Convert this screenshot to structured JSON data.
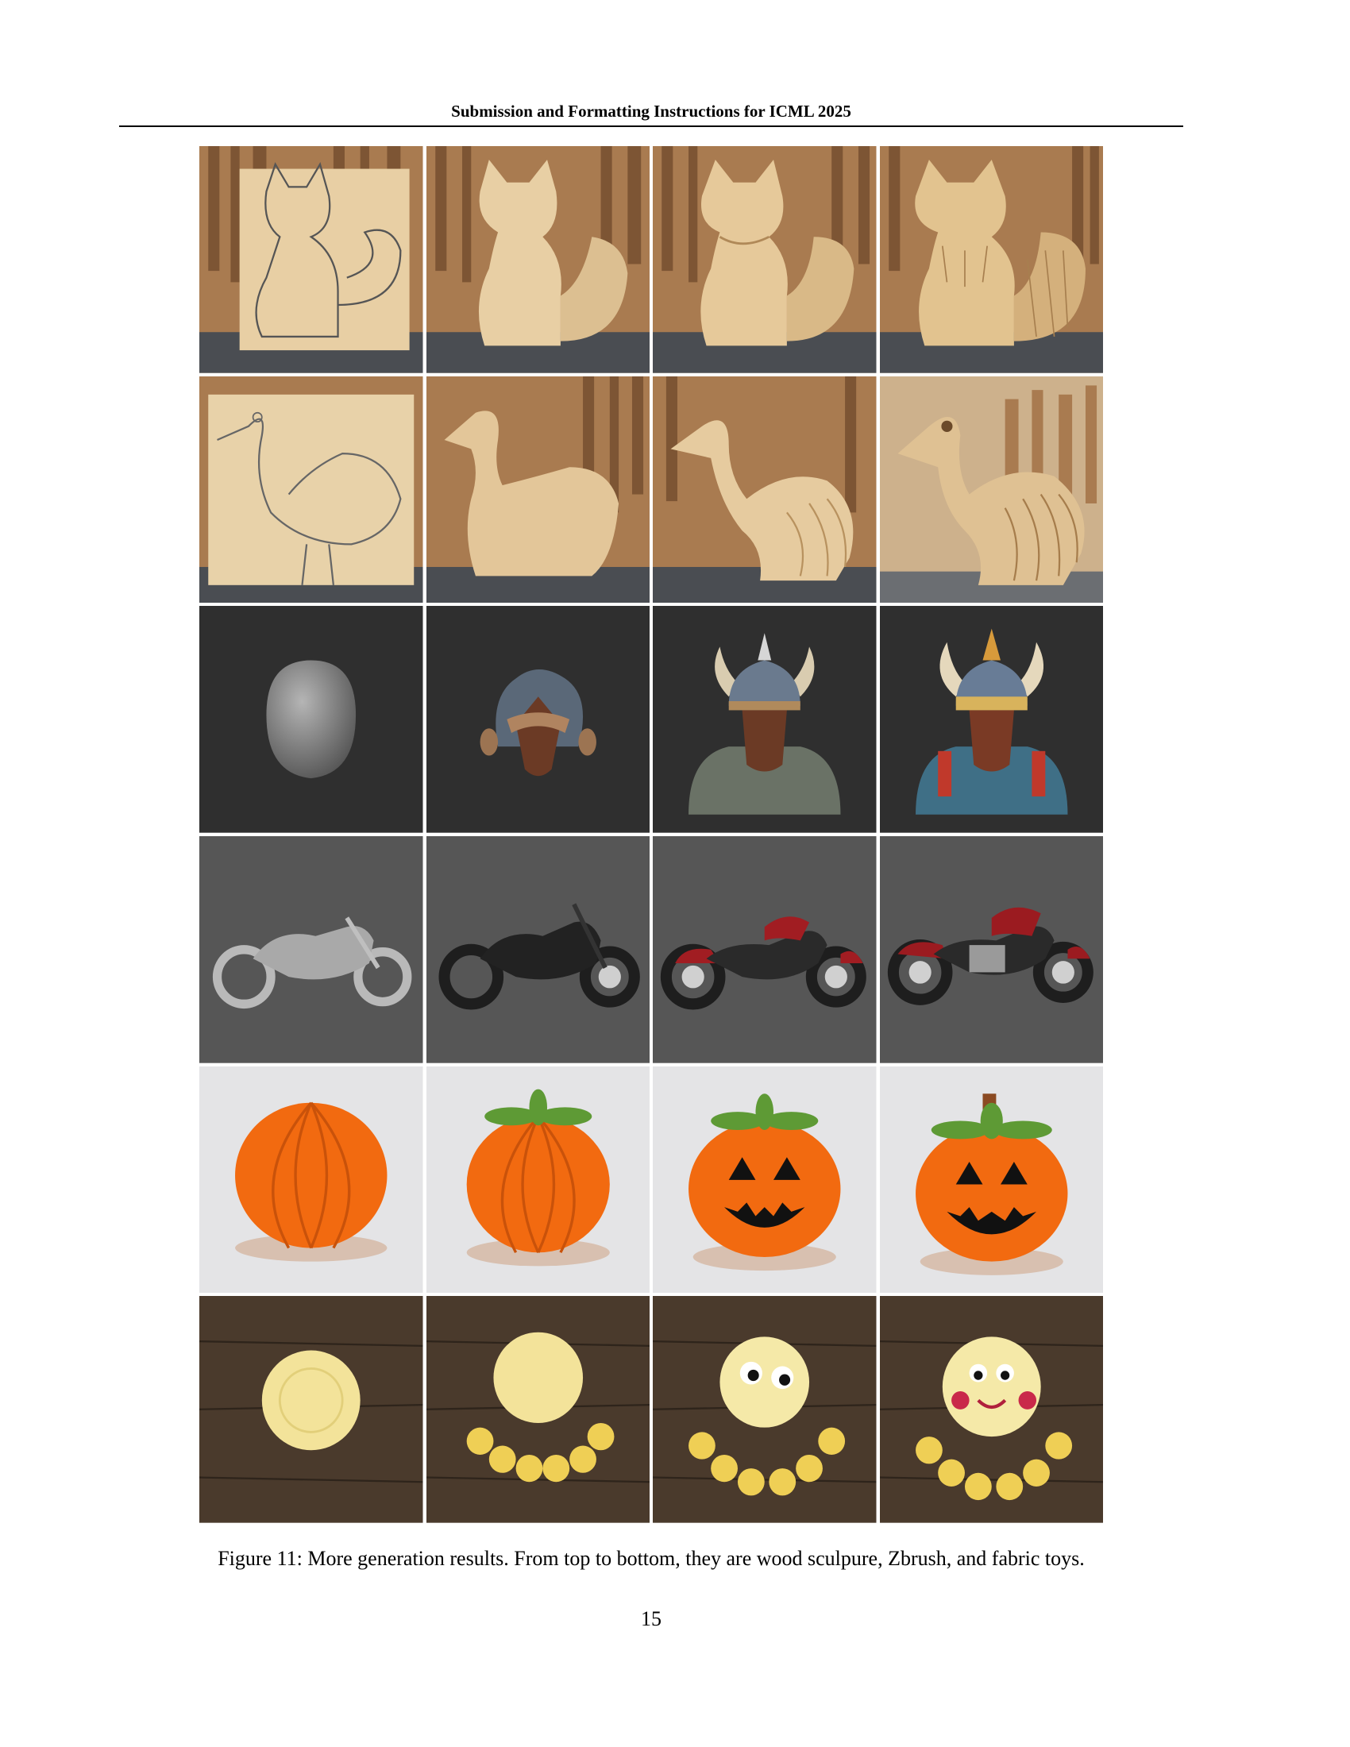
{
  "header": {
    "title": "Submission and Formatting Instructions for ICML 2025"
  },
  "figure": {
    "caption": "Figure 11: More generation results. From top to bottom, they are wood sculpure, Zbrush, and fabric toys.",
    "rows": [
      {
        "subject": "wooden fox carving",
        "background": "workshop"
      },
      {
        "subject": "wooden bird carving",
        "background": "workshop"
      },
      {
        "subject": "viking helmet bust",
        "background": "dark"
      },
      {
        "subject": "motorcycle",
        "background": "grey"
      },
      {
        "subject": "crochet pumpkin",
        "background": "light"
      },
      {
        "subject": "crochet octopus",
        "background": "wood"
      }
    ]
  },
  "page": {
    "number": "15"
  },
  "colors": {
    "wood_light": "#e8cfa4",
    "wood_mid": "#d9b987",
    "workshop_bg": "#a97b50",
    "dark_bg": "#2f2f2f",
    "grey_bg": "#565656",
    "pumpkin": "#f26a10",
    "leaf": "#5e9a35",
    "yarn_yellow": "#f3e39a",
    "plank": "#4a3a2c"
  }
}
